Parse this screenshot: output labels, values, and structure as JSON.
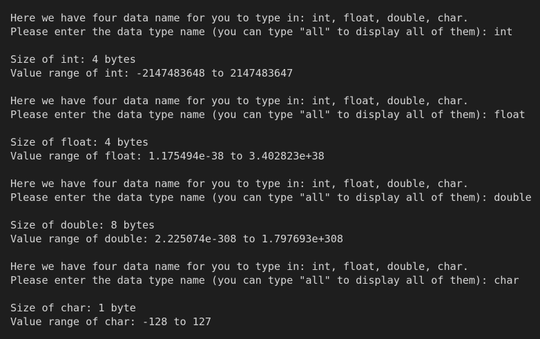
{
  "terminal": {
    "lines": [
      "Here we have four data name for you to type in: int, float, double, char.",
      "Please enter the data type name (you can type \"all\" to display all of them): int",
      "",
      "Size of int: 4 bytes",
      "Value range of int: -2147483648 to 2147483647",
      "",
      "Here we have four data name for you to type in: int, float, double, char.",
      "Please enter the data type name (you can type \"all\" to display all of them): float",
      "",
      "Size of float: 4 bytes",
      "Value range of float: 1.175494e-38 to 3.402823e+38",
      "",
      "Here we have four data name for you to type in: int, float, double, char.",
      "Please enter the data type name (you can type \"all\" to display all of them): double",
      "",
      "Size of double: 8 bytes",
      "Value range of double: 2.225074e-308 to 1.797693e+308",
      "",
      "Here we have four data name for you to type in: int, float, double, char.",
      "Please enter the data type name (you can type \"all\" to display all of them): char",
      "",
      "Size of char: 1 byte",
      "Value range of char: -128 to 127"
    ]
  }
}
